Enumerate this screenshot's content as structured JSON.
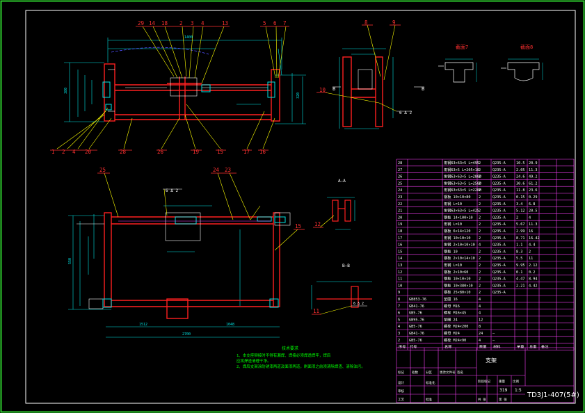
{
  "drawing": {
    "colors": {
      "background": "#000000",
      "frame": "#2ecc2e",
      "inner_border": "#ffffff",
      "steel": "#ff2020",
      "dimension": "#00e5e5",
      "leader": "#ffff00",
      "balloon": "#ff3030",
      "hidden": "#c040c0",
      "note": "#00ff00",
      "table_line": "#ff40ff",
      "table_text": "#ffffff"
    },
    "top_view_balloons": [
      "29",
      "14",
      "18",
      "2",
      "3",
      "4",
      "13",
      "5",
      "6",
      "7"
    ],
    "bottom_balloons_left": [
      "1",
      "2",
      "4",
      "20",
      "28",
      "26",
      "19",
      "15",
      "17",
      "16"
    ],
    "side_view_balloons": [
      "8",
      "9",
      "10"
    ],
    "front_view_balloons": [
      "25",
      "24",
      "23",
      "12",
      "11"
    ],
    "section_labels": {
      "sec1": "截面7",
      "sec2": "截面8",
      "aa": "A—A",
      "bb": "B—B"
    },
    "weld_labels": [
      "6 Δ 2",
      "6 Δ 2",
      "6 Δ 2"
    ],
    "notes": {
      "heading": "技术要求",
      "line1": "1、本支座铆接时不得有漏焊、焊接必须焊透焊牢，焊后",
      "line2": "   应将焊渣清理干净。",
      "line3": "2、焊后支架涂防锈漆两道及面漆两道，刷面漆之前须清除焊渣、清除油污。"
    }
  },
  "parts_table": {
    "rows": [
      [
        "28",
        "",
        "角钢63×63×5 L=495",
        "2",
        "Q235-A",
        "10.5",
        "20.9"
      ],
      [
        "27",
        "",
        "角钢63×5 L=205×10",
        "2",
        "Q235-A",
        "2.05",
        "11.3"
      ],
      [
        "26",
        "",
        "角钢63×63×5 L=2800",
        "2",
        "Q235-A",
        "24.6",
        "49.2"
      ],
      [
        "25",
        "",
        "角钢63×63×5 L=2500",
        "2",
        "Q235-A",
        "30.6",
        "61.2"
      ],
      [
        "24",
        "",
        "角钢63×63×5 L=2200",
        "2",
        "Q235-A",
        "11.8",
        "23.6"
      ],
      [
        "23",
        "",
        "钢板 10×10×80",
        "2",
        "Q235-A",
        "0.15",
        "0.29"
      ],
      [
        "22",
        "",
        "角钢 L=10",
        "2",
        "Q235-A",
        "3.4",
        "6.8"
      ],
      [
        "21",
        "",
        "角钢63×63×5 L=425",
        "2",
        "Q235-A",
        "5.12",
        "20.5"
      ],
      [
        "20",
        "",
        "钢板 14×100×10",
        "2",
        "Q235-A",
        "2",
        "4"
      ],
      [
        "19",
        "",
        "角钢 L=10",
        "2",
        "Q235-A",
        "5.67",
        "11.3"
      ],
      [
        "18",
        "",
        "钢板 6×14×120",
        "2",
        "Q235-A",
        "2.99",
        "16"
      ],
      [
        "17",
        "",
        "角钢 10×10×10",
        "2",
        "Q235-A",
        "8.71",
        "16.42"
      ],
      [
        "16",
        "",
        "角钢 2×10×10×10",
        "4",
        "Q235-A",
        "1.1",
        "4.4"
      ],
      [
        "15",
        "",
        "钢板 10",
        "2",
        "Q235-A",
        "8.3",
        "2"
      ],
      [
        "14",
        "",
        "钢板 2×10×14×10",
        "2",
        "Q235-A",
        "5.5",
        "11"
      ],
      [
        "13",
        "",
        "角钢 L=10",
        "2",
        "Q235-A",
        "9.95",
        "2.12"
      ],
      [
        "12",
        "",
        "钢板 2×10×60",
        "2",
        "Q235-A",
        "0.1",
        "0.2"
      ],
      [
        "11",
        "",
        "钢板 10×10×10",
        "2",
        "Q235-A",
        "4.47",
        "8.94"
      ],
      [
        "10",
        "",
        "钢板 10×380×10",
        "2",
        "Q235-A",
        "2.21",
        "4.42"
      ],
      [
        "9",
        "",
        "钢板 25×80×10",
        "2",
        "Q235-A",
        "",
        ""
      ],
      [
        "8",
        "GB853-76",
        "垫圈 16",
        "4",
        "",
        "",
        ""
      ],
      [
        "7",
        "GB41-76",
        "螺母 M16",
        "4",
        "",
        "",
        ""
      ],
      [
        "6",
        "GB5-76",
        "螺栓 M16×45",
        "4",
        "",
        "",
        ""
      ],
      [
        "5",
        "GB95-76",
        "垫圈 24",
        "12",
        "",
        "",
        ""
      ],
      [
        "4",
        "GB5-76",
        "螺栓 M24×200",
        "8",
        "",
        "",
        ""
      ],
      [
        "3",
        "GB41-76",
        "螺母 M24",
        "24",
        "—",
        "",
        ""
      ],
      [
        "2",
        "GB5-76",
        "螺栓 M24×90",
        "4",
        "—",
        "",
        ""
      ]
    ],
    "header": [
      "序号",
      "代号",
      "名称",
      "数量",
      "材料",
      "单重",
      "总重",
      "备注"
    ]
  },
  "title_block": {
    "part_name": "支架",
    "drawing_no": "TD3J1-407(5#)",
    "scale": "1:5",
    "weight": "319",
    "labels": [
      "标记",
      "处数",
      "分区",
      "更改文件号",
      "签名",
      "年月日",
      "设计",
      "标准化",
      "审核",
      "工艺",
      "批准",
      "阶段标记",
      "重量",
      "比例",
      "共 张",
      "第 张"
    ]
  }
}
